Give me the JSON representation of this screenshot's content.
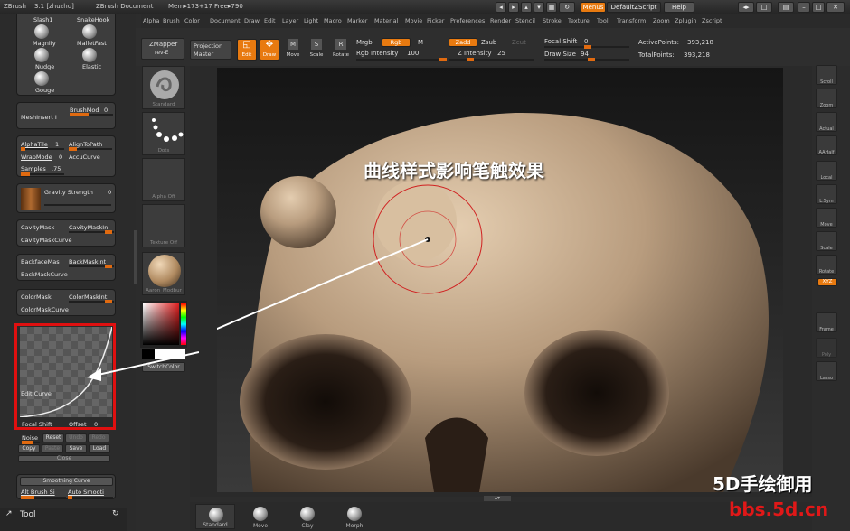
{
  "titlebar": {
    "app": "ZBrush",
    "version": "3.1 [zhuzhu]",
    "document": "ZBrush Document",
    "mem": "Mem▸173+17 Free▸790",
    "menus_button": "Menus",
    "script_name": "DefaultZScript",
    "help_button": "Help"
  },
  "menubar": [
    "Alpha",
    "Brush",
    "Color",
    "Document",
    "Draw",
    "Edit",
    "Layer",
    "Light",
    "Macro",
    "Marker",
    "Material",
    "Movie",
    "Picker",
    "Preferences",
    "Render",
    "Stencil",
    "Stroke",
    "Texture",
    "Tool",
    "Transform",
    "Zoom",
    "Zplugin",
    "Zscript"
  ],
  "toolbar": {
    "zmapper": "ZMapper",
    "zmapper_sub": "rev-E",
    "projection": "Projection",
    "master": "Master",
    "edit": "Edit",
    "draw": "Draw",
    "move": "Move",
    "scale": "Scale",
    "rotate": "Rotate",
    "mrgb": "Mrgb",
    "rgb": "Rgb",
    "m": "M",
    "rgb_intensity_label": "Rgb Intensity",
    "rgb_intensity_value": "100",
    "zadd": "Zadd",
    "zsub": "Zsub",
    "zcut": "Zcut",
    "z_intensity_label": "Z Intensity",
    "z_intensity_value": "25",
    "focal_shift_label": "Focal Shift",
    "focal_shift_value": "0",
    "draw_size_label": "Draw Size",
    "draw_size_value": "94",
    "active_points_label": "ActivePoints:",
    "active_points_value": "393,218",
    "total_points_label": "TotalPoints:",
    "total_points_value": "393,218"
  },
  "left_panel": {
    "brushes": [
      "Slash1",
      "SnakeHook",
      "Magnify",
      "MalletFast",
      "Nudge",
      "Elastic",
      "Gouge"
    ],
    "brush_mod_label": "BrushMod",
    "brush_mod_value": "0",
    "mesh_insert": "MeshInsert I",
    "alpha_tile_label": "AlphaTile",
    "alpha_tile_value": "1",
    "align_to_path": "AlignToPath",
    "wrap_mode_label": "WrapMode",
    "wrap_mode_value": "0",
    "accu_curve": "AccuCurve",
    "samples_label": "Samples",
    "samples_value": ".75",
    "gravity_label": "Gravity Strength",
    "gravity_value": "0",
    "cavity_mask": "CavityMask",
    "cavity_mask_int": "CavityMaskIn",
    "cavity_mask_curve": "CavityMaskCurve",
    "backface_mask": "BackfaceMas",
    "backface_mask_int": "BackMaskInt",
    "backface_mask_curve": "BackMaskCurve",
    "color_mask": "ColorMask",
    "color_mask_int": "ColorMaskInt",
    "color_mask_curve": "ColorMaskCurve",
    "edit_curve": "Edit Curve",
    "curve_focal_shift_label": "Focal Shift",
    "curve_offset_label": "Offset",
    "curve_offset_value": "0",
    "noise": "Noise",
    "reset": "Reset",
    "undo": "Undo",
    "redo": "Redo",
    "copy": "Copy",
    "paste": "Paste",
    "save": "Save",
    "load": "Load",
    "close": "Close",
    "smoothing_curve": "Smoothing Curve",
    "alt_brush": "Alt Brush Si",
    "auto_smooth": "Auto Smooti",
    "tool_label": "Tool"
  },
  "shelf": {
    "standard": "Standard",
    "dots": "Dots",
    "alpha_off": "Alpha Off",
    "texture_off": "Texture Off",
    "material": "Aaron_Modbur",
    "switch_color": "SwitchColor"
  },
  "annotation": "曲线样式影响笔触效果",
  "right_panel": [
    "Scroll",
    "Zoom",
    "Actual",
    "AAHalf",
    "Local",
    "L.Sym",
    "Move",
    "Scale",
    "Rotate",
    "XYZ",
    "Frame",
    "Poly",
    "Lasso"
  ],
  "bottom_tray": [
    "Standard",
    "Move",
    "Clay",
    "Morph"
  ],
  "watermark": {
    "line1": "5D手绘御用",
    "line2": "bbs.5d.cn"
  },
  "colors": {
    "accent": "#e87a10",
    "highlight_box": "#e01010",
    "watermark_red": "#e01818"
  }
}
